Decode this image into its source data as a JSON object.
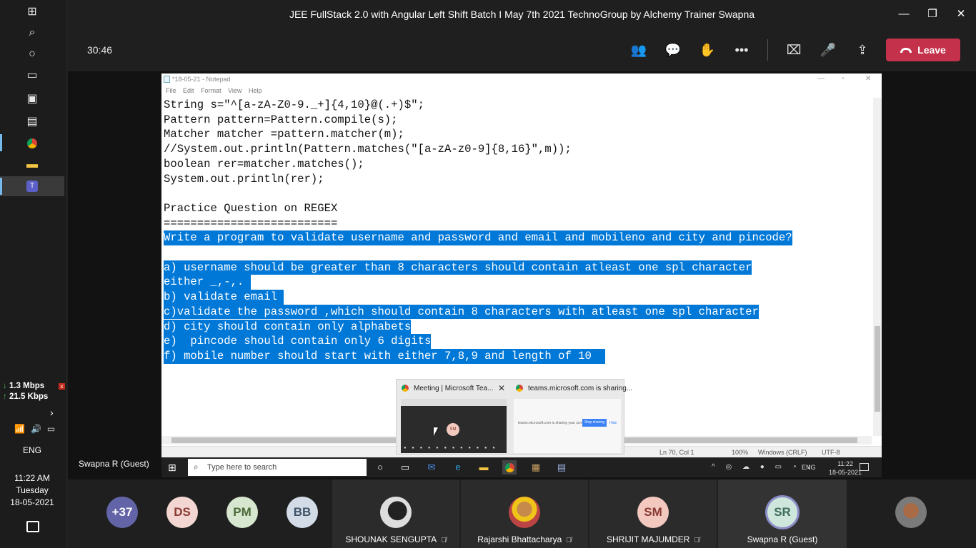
{
  "os_taskbar": {
    "net_down": "1.3 Mbps",
    "net_up": "21.5 Kbps",
    "language": "ENG",
    "time": "11:22 AM",
    "day": "Tuesday",
    "date": "18-05-2021"
  },
  "window": {
    "title": "JEE FullStack 2.0 with Angular Left Shift Batch I May 7th 2021 TechnoGroup by Alchemy Trainer Swapna"
  },
  "meeting": {
    "timer": "30:46",
    "leave_label": "Leave",
    "leave_color": "#c4314b",
    "presenter": "Swapna R (Guest)"
  },
  "notepad": {
    "title": "*18-05-21 - Notepad",
    "menu": [
      "File",
      "Edit",
      "Format",
      "View",
      "Help"
    ],
    "lines": [
      {
        "text": "String s=\"^[a-zA-Z0-9._+]{4,10}@(.+)$\";",
        "selected": false
      },
      {
        "text": "Pattern pattern=Pattern.compile(s);",
        "selected": false
      },
      {
        "text": "Matcher matcher =pattern.matcher(m);",
        "selected": false
      },
      {
        "text": "//System.out.println(Pattern.matches(\"[a-zA-z0-9]{8,16}\",m));",
        "selected": false
      },
      {
        "text": "boolean rer=matcher.matches();",
        "selected": false
      },
      {
        "text": "System.out.println(rer);",
        "selected": false
      },
      {
        "text": "",
        "selected": false
      },
      {
        "text": "Practice Question on REGEX",
        "selected": false
      },
      {
        "text": "==========================",
        "selected": false
      },
      {
        "text": "Write a program to validate username and password and email and mobileno and city and pincode?",
        "selected": true
      },
      {
        "text": "",
        "selected": false
      },
      {
        "text": "a) username should be greater than 8 characters should contain atleast one spl character",
        "selected": true
      },
      {
        "text": "either _,-,. ",
        "selected": true
      },
      {
        "text": "b) validate email ",
        "selected": true
      },
      {
        "text": "c)validate the password ,which should contain 8 characters with atleast one spl character",
        "selected": true
      },
      {
        "text": "d) city should contain only alphabets",
        "selected": true
      },
      {
        "text": "e)  pincode should contain only 6 digits",
        "selected": true
      },
      {
        "text": "f) mobile number should start with either 7,8,9 and length of 10  ",
        "selected": true
      }
    ],
    "status": {
      "position": "Ln 70, Col 1",
      "zoom": "100%",
      "line_ending": "Windows (CRLF)",
      "encoding": "UTF-8"
    },
    "selection_color": "#0078d7"
  },
  "inner_taskbar": {
    "search_placeholder": "Type here to search",
    "language": "ENG",
    "time": "11:22",
    "date": "18-05-2021"
  },
  "preview": {
    "tab1_title": "Meeting | Microsoft Tea...",
    "tab2_title": "teams.microsoft.com is sharing...",
    "avatar_initials": "SM",
    "sharing_text": "teams.microsoft.com is sharing your screen.",
    "stop_label": "Stop sharing",
    "hide_label": "Hide"
  },
  "participants": [
    {
      "initials": "+37",
      "bg": "#6264a7",
      "fg": "#ffffff"
    },
    {
      "initials": "DS",
      "bg": "#f3d6d1",
      "fg": "#8a3a33"
    },
    {
      "initials": "PM",
      "bg": "#d7e6cf",
      "fg": "#4b6a3a"
    },
    {
      "initials": "BB",
      "bg": "#d3dce6",
      "fg": "#3f5368"
    }
  ],
  "video_tiles": [
    {
      "name": "SHOUNAK SENGUPTA"
    },
    {
      "name": "Rajarshi Bhattacharya"
    },
    {
      "name": "SHRIJIT MAJUMDER",
      "initials": "SM"
    },
    {
      "name": "Swapna R (Guest)",
      "initials": "SR"
    }
  ]
}
